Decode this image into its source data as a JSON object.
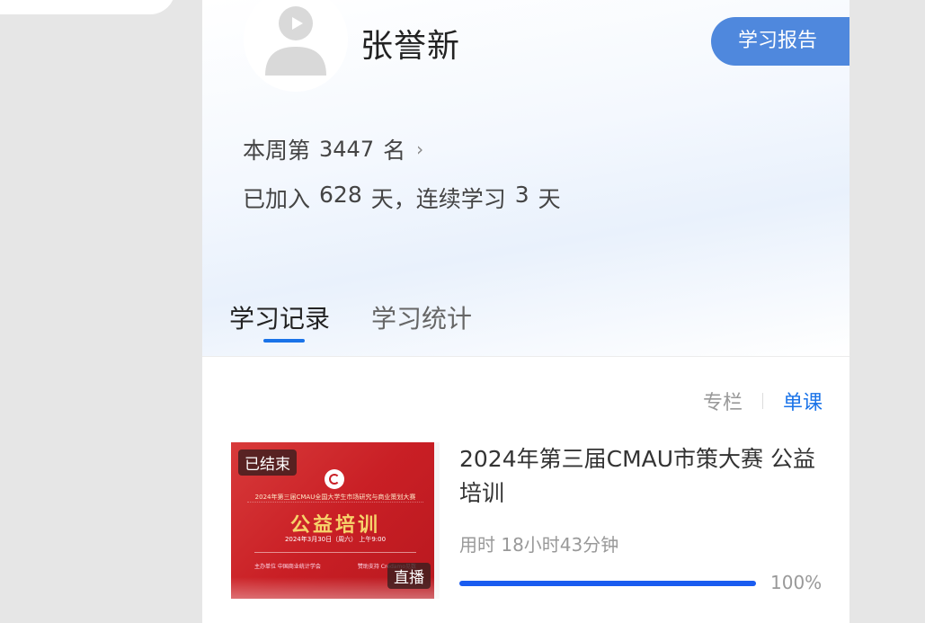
{
  "profile": {
    "name": "张誉新",
    "report_button": "学习报告",
    "rank": {
      "prefix": "本周第",
      "value": "3447",
      "suffix": "名"
    },
    "join": {
      "prefix": "已加入",
      "days": "628",
      "mid": "天，连续学习",
      "streak": "3",
      "suffix": "天"
    }
  },
  "tabs": [
    {
      "label": "学习记录",
      "active": true
    },
    {
      "label": "学习统计",
      "active": false
    }
  ],
  "filter": {
    "options": [
      {
        "label": "专栏",
        "active": false
      },
      {
        "label": "单课",
        "active": true
      }
    ]
  },
  "courses": [
    {
      "title": "2024年第三届CMAU市策大赛 公益培训",
      "status_badge": "已结束",
      "type_badge": "直播",
      "thumbnail": {
        "headline": "2024年第三届CMAU全国大学生市场研究与商业策划大赛",
        "title": "公益培训",
        "date": "2024年3月30日（周六） 上午9:00",
        "foot_left": "主办单位 中国商业统计学会",
        "foot_right": "赞助支持 Credamo见数"
      },
      "duration": "用时 18小时43分钟",
      "progress": 100,
      "progress_label": "100%"
    }
  ],
  "colors": {
    "accent": "#1a73e8",
    "report_button": "#4f88dd",
    "progress": "#1a5cf0",
    "thumbnail_red": "#c91f25"
  },
  "icons": {
    "avatar": "user-avatar-placeholder-icon",
    "rank_arrow": "chevron-right-icon"
  }
}
